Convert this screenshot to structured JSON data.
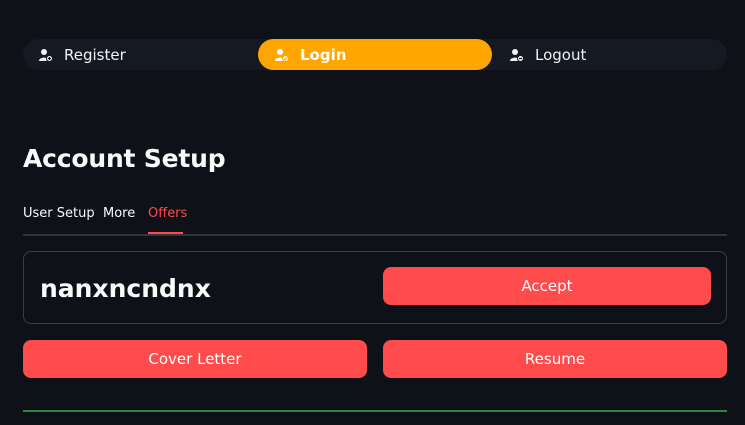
{
  "nav": {
    "items": [
      {
        "label": "Register",
        "icon": "user-add-icon",
        "active": false
      },
      {
        "label": "Login",
        "icon": "user-check-icon",
        "active": true
      },
      {
        "label": "Logout",
        "icon": "user-remove-icon",
        "active": false
      }
    ]
  },
  "title": "Account Setup",
  "tabs": [
    {
      "label": "User Setup",
      "active": false
    },
    {
      "label": "More",
      "active": false
    },
    {
      "label": "Offers",
      "active": true
    }
  ],
  "offer": {
    "name": "nanxncndnx",
    "accept_label": "Accept"
  },
  "actions": {
    "cover_letter_label": "Cover Letter",
    "resume_label": "Resume"
  },
  "colors": {
    "background": "#0e1117",
    "nav_active": "#ffa500",
    "accent": "#ff4b4b",
    "divider": "#2e8540"
  }
}
